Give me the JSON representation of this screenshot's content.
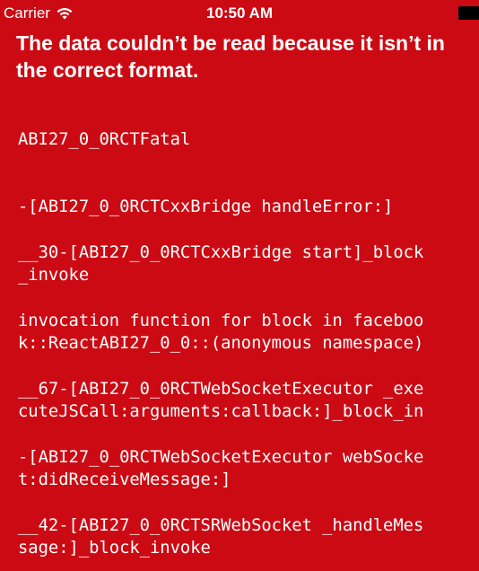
{
  "status_bar": {
    "carrier": "Carrier",
    "time": "10:50 AM",
    "wifi_icon": "wifi-icon",
    "battery_icon": "battery-icon"
  },
  "error": {
    "message": "The data couldn’t be read because it isn’t in the correct format.",
    "background_color": "#cc0a13",
    "text_color": "#ffffff"
  },
  "stack": [
    "ABI27_0_0RCTFatal",
    "-[ABI27_0_0RCTCxxBridge handleError:]",
    "__30-[ABI27_0_0RCTCxxBridge start]_block\n_invoke",
    "invocation function for block in faceboo\nk::ReactABI27_0_0::(anonymous namespace)",
    "__67-[ABI27_0_0RCTWebSocketExecutor _exe\ncuteJSCall:arguments:callback:]_block_in",
    "-[ABI27_0_0RCTWebSocketExecutor webSocke\nt:didReceiveMessage:]",
    "__42-[ABI27_0_0RCTSRWebSocket _handleMes\nsage:]_block_invoke"
  ]
}
